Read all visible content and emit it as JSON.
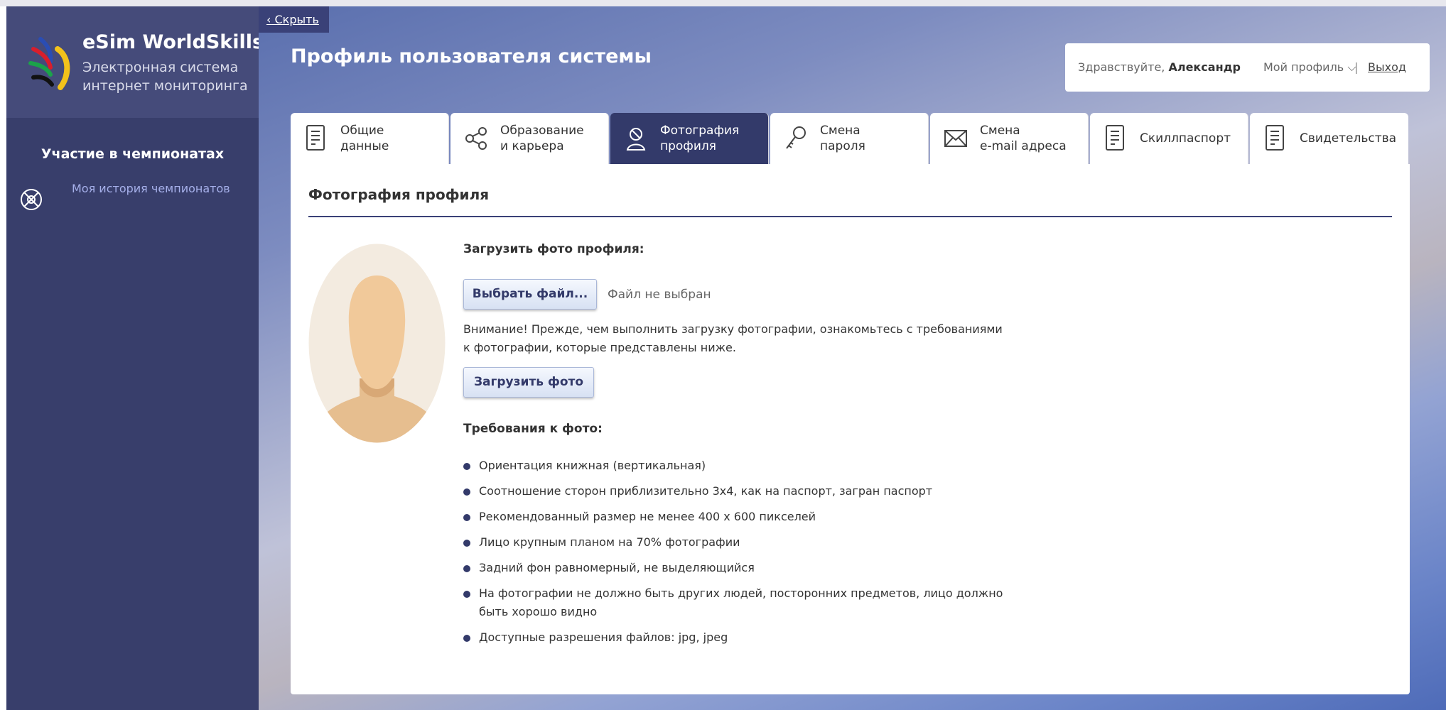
{
  "brand": {
    "title": "eSim WorldSkills",
    "subtitle": "Электронная система интернет мониторинга"
  },
  "sidebar": {
    "heading": "Участие в чемпионатах",
    "items": [
      {
        "label": "Моя история чемпионатов",
        "icon": "globe-icon"
      }
    ]
  },
  "topbar": {
    "hide_label": "Скрыть",
    "page_title": "Профиль пользователя системы",
    "greeting": "Здравствуйте,",
    "user_name": "Александр",
    "my_profile": "Мой профиль",
    "separator": "|",
    "logout": "Выход"
  },
  "tabs": [
    {
      "label": "Общие\nданные",
      "icon": "document-icon",
      "active": false
    },
    {
      "label": "Образование\nи карьера",
      "icon": "share-icon",
      "active": false
    },
    {
      "label": "Фотография\nпрофиля",
      "icon": "photo-icon",
      "active": true
    },
    {
      "label": "Смена\nпароля",
      "icon": "key-icon",
      "active": false
    },
    {
      "label": "Смена\ne-mail адреса",
      "icon": "envelope-icon",
      "active": false
    },
    {
      "label": "Скиллпаспорт",
      "icon": "document-icon",
      "active": false
    },
    {
      "label": "Свидетельства",
      "icon": "document-icon",
      "active": false
    }
  ],
  "panel": {
    "title": "Фотография профиля",
    "upload_label": "Загрузить фото профиля:",
    "choose_file_button": "Выбрать файл...",
    "file_status": "Файл не выбран",
    "warning": "Внимание! Прежде, чем выполнить загрузку фотографии, ознакомьтесь с требованиями к фотографии, которые представлены ниже.",
    "upload_button": "Загрузить фото",
    "requirements_title": "Требования к фото:",
    "requirements": [
      "Ориентация книжная (вертикальная)",
      "Соотношение сторон приблизительно 3х4, как на паспорт, загран паспорт",
      "Рекомендованный размер не менее 400 х 600 пикселей",
      "Лицо крупным планом на 70% фотографии",
      "Задний фон равномерный, не выделяющийся",
      "На фотографии не должно быть других людей, посторонних предметов, лицо должно быть хорошо видно",
      "Доступные разрешения файлов: jpg, jpeg"
    ]
  },
  "colors": {
    "sidebar": "#383e6b",
    "logo_block": "#454b7a",
    "active_tab": "#333a6a",
    "accent": "#3a4178",
    "link": "#a6b0ea"
  }
}
